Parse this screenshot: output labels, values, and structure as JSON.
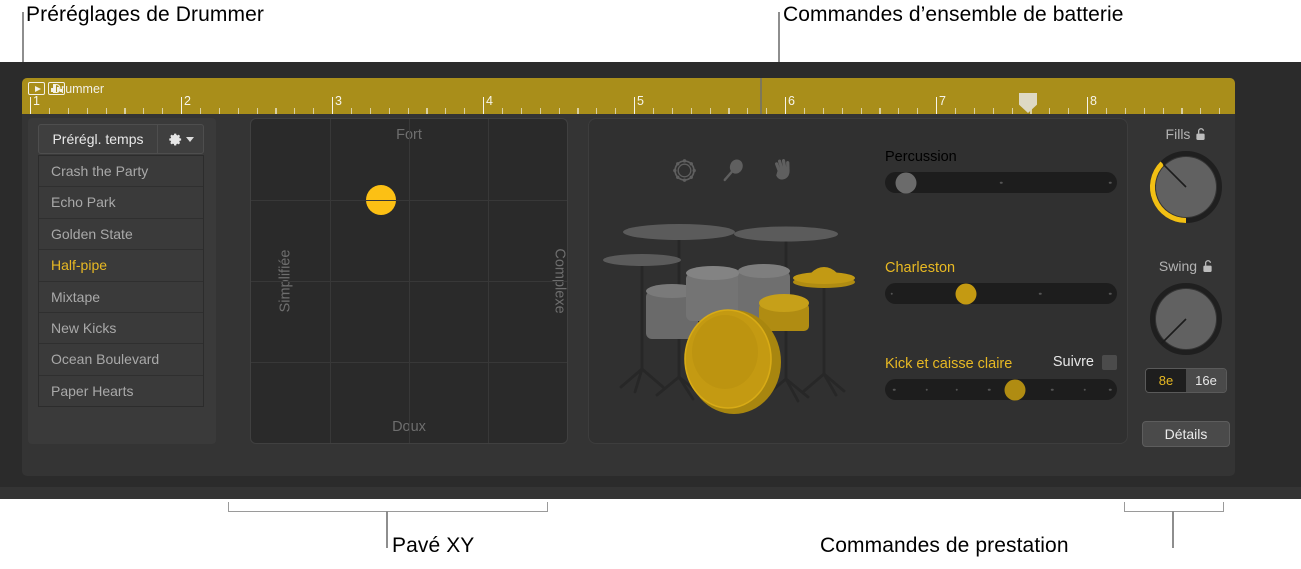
{
  "annotations": [
    {
      "id": "presets",
      "label": "Préréglages de Drummer"
    },
    {
      "id": "kit",
      "label": "Commandes d’ensemble de batterie"
    },
    {
      "id": "xy",
      "label": "Pavé XY"
    },
    {
      "id": "perf",
      "label": "Commandes de prestation"
    }
  ],
  "ruler": {
    "region_name": "Drummer",
    "bars": [
      "1",
      "2",
      "3",
      "4",
      "5",
      "6",
      "7",
      "8"
    ],
    "playhead_bar": "7.5",
    "color": "#a98e1a"
  },
  "presets": {
    "header_title": "Prérégl. temps",
    "gear_icon": "gear-icon",
    "chevron_icon": "chevron-down-icon",
    "items": [
      {
        "label": "Crash the Party",
        "selected": false
      },
      {
        "label": "Echo Park",
        "selected": false
      },
      {
        "label": "Golden State",
        "selected": false
      },
      {
        "label": "Half-pipe",
        "selected": true
      },
      {
        "label": "Mixtape",
        "selected": false
      },
      {
        "label": "New Kicks",
        "selected": false
      },
      {
        "label": "Ocean Boulevard",
        "selected": false
      },
      {
        "label": "Paper Hearts",
        "selected": false
      }
    ],
    "selected_color": "#e8b923"
  },
  "xy_pad": {
    "top_label": "Fort",
    "bottom_label": "Doux",
    "left_label": "Simplifiée",
    "right_label": "Complexe",
    "puck_color": "#fcc014",
    "puck_x_pct": 41,
    "puck_y_pct": 25,
    "grid_divisions": 4
  },
  "kit": {
    "percussion_icons": [
      "tambourine-icon",
      "shaker-icon",
      "clap-hand-icon"
    ],
    "sliders": [
      {
        "name": "percussion",
        "label": "Percussion",
        "value_pct": 2,
        "enabled": false,
        "label_color": "#6f6f6f",
        "knob_color": "#6b6b6b",
        "ticks": [
          50,
          97
        ]
      },
      {
        "name": "charleston",
        "label": "Charleston",
        "value_pct": 35,
        "enabled": true,
        "label_color": "#e8b923",
        "knob_color": "#c49a12",
        "ticks": [
          3,
          35,
          67,
          97
        ]
      },
      {
        "name": "kick-snare",
        "label": "Kick et caisse claire",
        "value_pct": 55,
        "enabled": true,
        "label_color": "#e8b923",
        "knob_color": "#c49a12",
        "ticks": [
          4,
          18,
          31,
          45,
          59,
          72,
          86,
          97
        ]
      }
    ],
    "follow_label": "Suivre",
    "follow_checked": false
  },
  "performance": {
    "fills": {
      "label": "Fills",
      "lock_icon": "lock-open-icon",
      "value_deg": -128,
      "arc_color": "#f2c014"
    },
    "swing": {
      "label": "Swing",
      "lock_icon": "lock-open-icon",
      "value_deg": -145
    },
    "grid_options": [
      {
        "label": "8e",
        "selected": true
      },
      {
        "label": "16e",
        "selected": false
      }
    ],
    "details_label": "Détails"
  }
}
